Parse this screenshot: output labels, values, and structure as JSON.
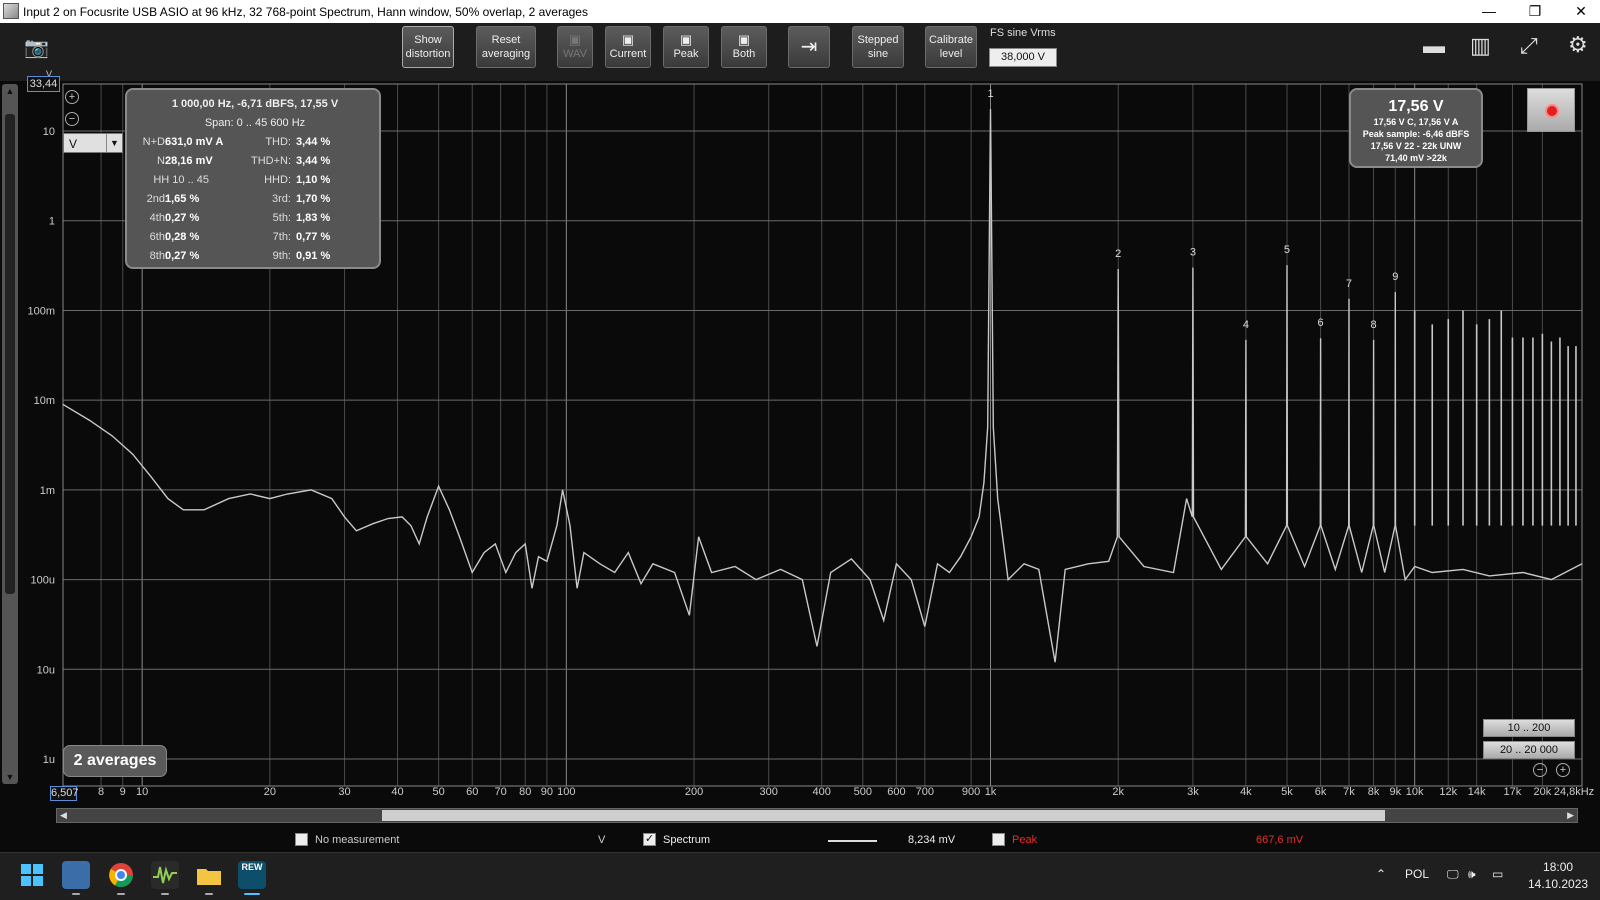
{
  "window": {
    "title": "Input 2 on Focusrite USB ASIO at 96 kHz, 32 768-point Spectrum, Hann window, 50% overlap, 2 averages",
    "minimize": "—",
    "maximize": "❐",
    "close": "✕"
  },
  "toolbar": {
    "show_distortion": [
      "Show",
      "distortion"
    ],
    "reset_averaging": [
      "Reset",
      "averaging"
    ],
    "wav": "WAV",
    "current": "Current",
    "peak": "Peak",
    "both": "Both",
    "stepped_sine": [
      "Stepped",
      "sine"
    ],
    "calibrate_level": [
      "Calibrate",
      "level"
    ],
    "fs_label": "FS sine Vrms",
    "fs_value": "38,000 V"
  },
  "y_axis": {
    "top_value": "33,44",
    "unit_marker": "V",
    "unit_select": "V",
    "ticks": [
      "10",
      "1",
      "100m",
      "10m",
      "1m",
      "100u",
      "10u",
      "1u"
    ]
  },
  "x_axis": {
    "first": "6,507",
    "ticks": [
      {
        "f": 8,
        "label": "8"
      },
      {
        "f": 9,
        "label": "9"
      },
      {
        "f": 10,
        "label": "10"
      },
      {
        "f": 20,
        "label": "20"
      },
      {
        "f": 30,
        "label": "30"
      },
      {
        "f": 40,
        "label": "40"
      },
      {
        "f": 50,
        "label": "50"
      },
      {
        "f": 60,
        "label": "60"
      },
      {
        "f": 70,
        "label": "70"
      },
      {
        "f": 80,
        "label": "80"
      },
      {
        "f": 90,
        "label": "90"
      },
      {
        "f": 100,
        "label": "100"
      },
      {
        "f": 200,
        "label": "200"
      },
      {
        "f": 300,
        "label": "300"
      },
      {
        "f": 400,
        "label": "400"
      },
      {
        "f": 500,
        "label": "500"
      },
      {
        "f": 600,
        "label": "600"
      },
      {
        "f": 700,
        "label": "700"
      },
      {
        "f": 900,
        "label": "900"
      },
      {
        "f": 1000,
        "label": "1k"
      },
      {
        "f": 2000,
        "label": "2k"
      },
      {
        "f": 3000,
        "label": "3k"
      },
      {
        "f": 4000,
        "label": "4k"
      },
      {
        "f": 5000,
        "label": "5k"
      },
      {
        "f": 6000,
        "label": "6k"
      },
      {
        "f": 7000,
        "label": "7k"
      },
      {
        "f": 8000,
        "label": "8k"
      },
      {
        "f": 9000,
        "label": "9k"
      },
      {
        "f": 10000,
        "label": "10k"
      },
      {
        "f": 12000,
        "label": "12k"
      },
      {
        "f": 14000,
        "label": "14k"
      },
      {
        "f": 17000,
        "label": "17k"
      },
      {
        "f": 20000,
        "label": "20k"
      },
      {
        "f": 24800,
        "label": "24,8kHz"
      }
    ]
  },
  "info": {
    "header": "1 000,00 Hz, -6,71 dBFS, 17,55 V",
    "span": "Span: 0 .. 45 600 Hz",
    "rows": [
      {
        "l1": "N+D:",
        "v1": "631,0 mV A",
        "l2": "THD:",
        "v2": "3,44 %"
      },
      {
        "l1": "N:",
        "v1": "28,16 mV",
        "l2": "THD+N:",
        "v2": "3,44 %"
      },
      {
        "l1": "HH 10 .. 45",
        "v1": "",
        "l2": "HHD:",
        "v2": "1,10 %"
      },
      {
        "l1": "2nd:",
        "v1": "1,65 %",
        "l2": "3rd:",
        "v2": "1,70 %"
      },
      {
        "l1": "4th:",
        "v1": "0,27 %",
        "l2": "5th:",
        "v2": "1,83 %"
      },
      {
        "l1": "6th:",
        "v1": "0,28 %",
        "l2": "7th:",
        "v2": "0,77 %"
      },
      {
        "l1": "8th:",
        "v1": "0,27 %",
        "l2": "9th:",
        "v2": "0,91 %"
      }
    ]
  },
  "rms": {
    "value": "17,56 V",
    "line1": "17,56 V C, 17,56 V A",
    "line2": "Peak sample: -6,46 dBFS",
    "line3": "17,56 V 22 - 22k UNW",
    "line4": "71,40 mV >22k"
  },
  "averages_badge": "2 averages",
  "range_buttons": [
    "10 .. 200",
    "20 .. 20 000"
  ],
  "legend": {
    "no_measurement": "No measurement",
    "unit": "V",
    "spectrum": "Spectrum",
    "spectrum_value": "8,234 mV",
    "peak": "Peak",
    "peak_value": "667,6 mV",
    "spectrum_check": "✓"
  },
  "tray": {
    "lang": "POL",
    "time": "18:00",
    "date": "14.10.2023"
  },
  "taskbar_app_label": "REW",
  "colors": {
    "plot_bg": "#0a0a0a",
    "grid": "#5a5a5a",
    "trace": "#c8c8c8",
    "peak_red": "#e03030"
  },
  "chart_data": {
    "type": "line",
    "x_scale": "log",
    "y_scale": "log",
    "xlim": [
      6.507,
      24800
    ],
    "ylim": [
      5e-07,
      33.44
    ],
    "xlabel": "Hz",
    "ylabel": "V",
    "series": [
      {
        "name": "Spectrum",
        "points": [
          [
            6.5,
            0.009
          ],
          [
            7.5,
            0.006
          ],
          [
            8.5,
            0.004
          ],
          [
            9.5,
            0.0025
          ],
          [
            10.5,
            0.0014
          ],
          [
            11.5,
            0.0008
          ],
          [
            12.5,
            0.0006
          ],
          [
            14,
            0.0006
          ],
          [
            16,
            0.0008
          ],
          [
            18,
            0.0009
          ],
          [
            20,
            0.0008
          ],
          [
            22,
            0.0009
          ],
          [
            25,
            0.001
          ],
          [
            28,
            0.0008
          ],
          [
            30,
            0.0005
          ],
          [
            32,
            0.00035
          ],
          [
            35,
            0.00042
          ],
          [
            38,
            0.00048
          ],
          [
            41,
            0.0005
          ],
          [
            43,
            0.0004
          ],
          [
            45,
            0.00025
          ],
          [
            47,
            0.0005
          ],
          [
            50,
            0.0011
          ],
          [
            53,
            0.0006
          ],
          [
            56,
            0.0003
          ],
          [
            60,
            0.00012
          ],
          [
            64,
            0.0002
          ],
          [
            68,
            0.00025
          ],
          [
            72,
            0.00012
          ],
          [
            76,
            0.0002
          ],
          [
            80,
            0.00025
          ],
          [
            83,
            8e-05
          ],
          [
            86,
            0.00018
          ],
          [
            90,
            0.00016
          ],
          [
            95,
            0.0004
          ],
          [
            98,
            0.001
          ],
          [
            102,
            0.0004
          ],
          [
            106,
            8e-05
          ],
          [
            110,
            0.0002
          ],
          [
            120,
            0.00015
          ],
          [
            130,
            0.00012
          ],
          [
            140,
            0.0002
          ],
          [
            150,
            9e-05
          ],
          [
            160,
            0.00015
          ],
          [
            180,
            0.00012
          ],
          [
            195,
            4e-05
          ],
          [
            205,
            0.0003
          ],
          [
            220,
            0.00012
          ],
          [
            250,
            0.00014
          ],
          [
            280,
            0.0001
          ],
          [
            320,
            0.00013
          ],
          [
            360,
            0.0001
          ],
          [
            390,
            1.8e-05
          ],
          [
            420,
            0.00012
          ],
          [
            470,
            0.00017
          ],
          [
            520,
            0.0001
          ],
          [
            560,
            3.5e-05
          ],
          [
            600,
            0.00015
          ],
          [
            650,
            0.0001
          ],
          [
            700,
            3e-05
          ],
          [
            750,
            0.00015
          ],
          [
            800,
            0.00012
          ],
          [
            850,
            0.00018
          ],
          [
            900,
            0.0003
          ],
          [
            940,
            0.0005
          ],
          [
            965,
            0.0012
          ],
          [
            985,
            0.005
          ],
          [
            998,
            6
          ],
          [
            1000,
            17.55
          ],
          [
            1002,
            6
          ],
          [
            1015,
            0.005
          ],
          [
            1040,
            0.0008
          ],
          [
            1100,
            0.0001
          ],
          [
            1200,
            0.00015
          ],
          [
            1300,
            0.00013
          ],
          [
            1420,
            1.2e-05
          ],
          [
            1500,
            0.00013
          ],
          [
            1700,
            0.00015
          ],
          [
            1900,
            0.00016
          ],
          [
            1990,
            0.0003
          ],
          [
            2000,
            0.29
          ],
          [
            2010,
            0.0003
          ],
          [
            2300,
            0.00014
          ],
          [
            2700,
            0.00012
          ],
          [
            2900,
            0.0008
          ],
          [
            2990,
            0.0005
          ],
          [
            3000,
            0.3
          ],
          [
            3010,
            0.0005
          ],
          [
            3500,
            0.00013
          ],
          [
            3990,
            0.0003
          ],
          [
            4000,
            0.047
          ],
          [
            4010,
            0.0003
          ],
          [
            4500,
            0.00015
          ],
          [
            4990,
            0.0004
          ],
          [
            5000,
            0.32
          ],
          [
            5010,
            0.0004
          ],
          [
            5500,
            0.00014
          ],
          [
            5990,
            0.0004
          ],
          [
            6000,
            0.049
          ],
          [
            6010,
            0.0004
          ],
          [
            6500,
            0.00013
          ],
          [
            6990,
            0.0004
          ],
          [
            7000,
            0.135
          ],
          [
            7010,
            0.0004
          ],
          [
            7500,
            0.00012
          ],
          [
            7990,
            0.0004
          ],
          [
            8000,
            0.047
          ],
          [
            8010,
            0.0004
          ],
          [
            8500,
            0.00012
          ],
          [
            8990,
            0.0004
          ],
          [
            9000,
            0.16
          ],
          [
            9010,
            0.0004
          ],
          [
            9500,
            0.0001
          ],
          [
            10000,
            0.00014
          ],
          [
            11000,
            0.00012
          ],
          [
            13000,
            0.00013
          ],
          [
            15000,
            0.00011
          ],
          [
            18000,
            0.00012
          ],
          [
            21000,
            0.0001
          ],
          [
            24800,
            0.00015
          ]
        ]
      }
    ],
    "harmonics": [
      {
        "label": "1",
        "f": 1000,
        "v": 17.55
      },
      {
        "label": "2",
        "f": 2000,
        "v": 0.29
      },
      {
        "label": "3",
        "f": 3000,
        "v": 0.3
      },
      {
        "label": "4",
        "f": 4000,
        "v": 0.047
      },
      {
        "label": "5",
        "f": 5000,
        "v": 0.32
      },
      {
        "label": "6",
        "f": 6000,
        "v": 0.049
      },
      {
        "label": "7",
        "f": 7000,
        "v": 0.135
      },
      {
        "label": "8",
        "f": 8000,
        "v": 0.047
      },
      {
        "label": "9",
        "f": 9000,
        "v": 0.16
      }
    ],
    "higher_harmonics": [
      {
        "f": 10000,
        "v": 0.1
      },
      {
        "f": 11000,
        "v": 0.07
      },
      {
        "f": 12000,
        "v": 0.08
      },
      {
        "f": 13000,
        "v": 0.1
      },
      {
        "f": 14000,
        "v": 0.07
      },
      {
        "f": 15000,
        "v": 0.08
      },
      {
        "f": 16000,
        "v": 0.1
      },
      {
        "f": 17000,
        "v": 0.05
      },
      {
        "f": 18000,
        "v": 0.05
      },
      {
        "f": 19000,
        "v": 0.05
      },
      {
        "f": 20000,
        "v": 0.055
      },
      {
        "f": 21000,
        "v": 0.045
      },
      {
        "f": 22000,
        "v": 0.05
      },
      {
        "f": 23000,
        "v": 0.04
      },
      {
        "f": 24000,
        "v": 0.04
      }
    ]
  }
}
